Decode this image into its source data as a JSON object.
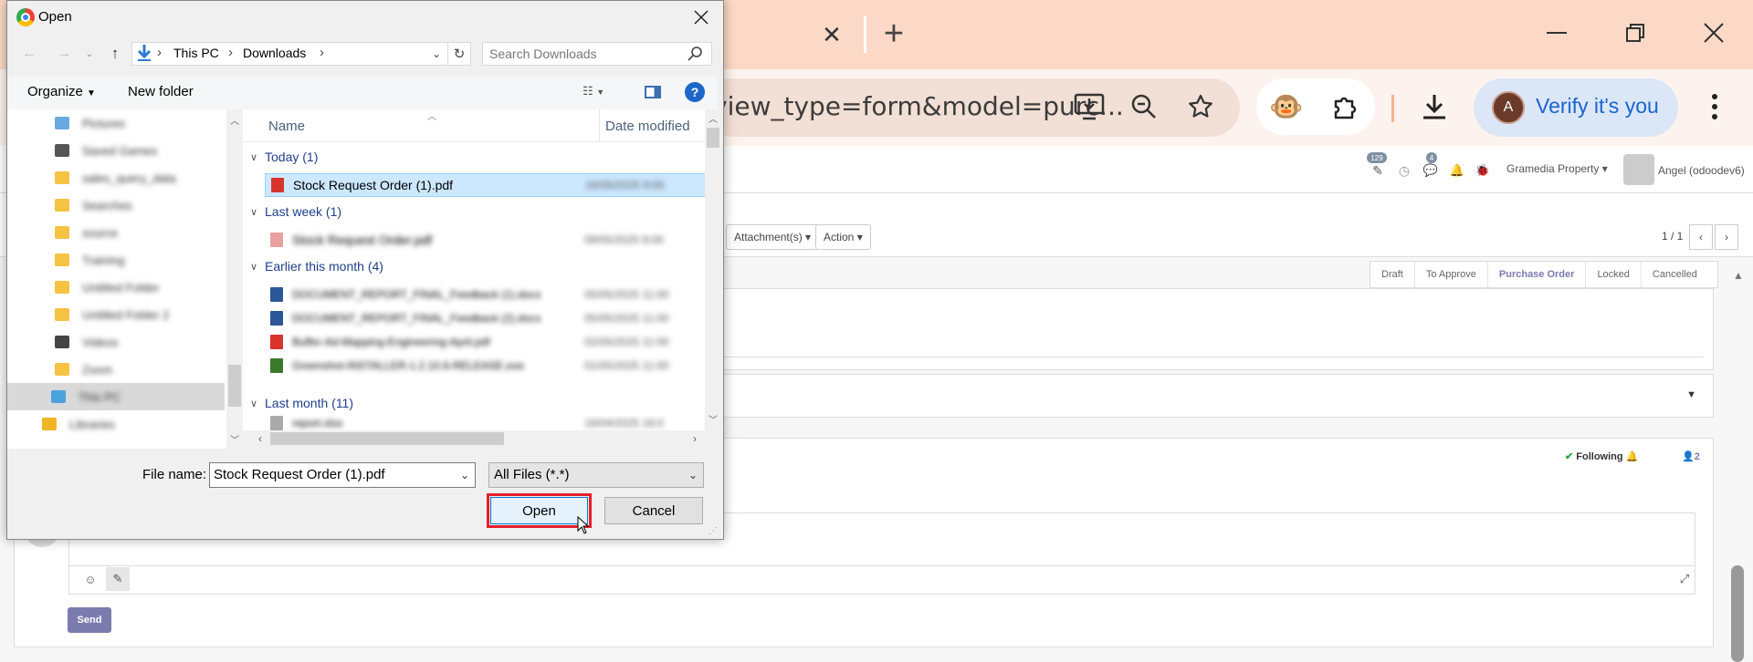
{
  "browser": {
    "tab_close": "✕",
    "tab_new": "+",
    "url": "view_type=form&model=purc...",
    "verify_label": "Verify it's you",
    "avatar_letter": "A"
  },
  "odoo": {
    "badge_activity": "129",
    "badge_messages": "4",
    "company": "Gramedia Property",
    "user": "Angel (odoodev6)",
    "attachments_label": "Attachment(s)",
    "action_label": "Action",
    "pager": "1 / 1",
    "stages": [
      "Draft",
      "To Approve",
      "Purchase Order",
      "Locked",
      "Cancelled"
    ],
    "active_stage": "Purchase Order",
    "following_label": "Following",
    "followers_count": "2",
    "send_label": "Send"
  },
  "dialog": {
    "title": "Open",
    "breadcrumb": [
      "This PC",
      "Downloads"
    ],
    "search_placeholder": "Search Downloads",
    "organize_label": "Organize",
    "new_folder_label": "New folder",
    "nav_items": [
      "Pictures",
      "Saved Games",
      "sales_query_data",
      "Searches",
      "source",
      "Training",
      "Untitled Folder",
      "Untitled Folder 2",
      "Videos",
      "Zoom",
      "This PC",
      "Libraries"
    ],
    "col_name": "Name",
    "col_date": "Date modified",
    "groups": [
      {
        "label": "Today (1)",
        "files": [
          {
            "name": "Stock Request Order (1).pdf",
            "date": "16/05/2025 9:00",
            "type": "pdf",
            "selected": true
          }
        ]
      },
      {
        "label": "Last week (1)",
        "files": [
          {
            "name": "Stock Request Order.pdf",
            "date": "09/05/2025 9:00",
            "type": "pdf",
            "selected": false
          }
        ]
      },
      {
        "label": "Earlier this month (4)",
        "files": [
          {
            "name": "DOCUMENT_REPORT_FINAL_Feedback (1).docx",
            "date": "05/05/2025 11:00",
            "type": "word"
          },
          {
            "name": "DOCUMENT_REPORT_FINAL_Feedback (2).docx",
            "date": "05/05/2025 11:00",
            "type": "word"
          },
          {
            "name": "Buffer-Ad-Mapping-Engineering-April.pdf",
            "date": "02/05/2025 11:00",
            "type": "pdf"
          },
          {
            "name": "Greenshot-INSTALLER-1.2.10.6-RELEASE.exe",
            "date": "01/05/2025 11:00",
            "type": "exe"
          }
        ]
      },
      {
        "label": "Last month (11)",
        "files": [
          {
            "name": "report.xlsx",
            "date": "16/04/2025 16:0",
            "type": "doc"
          }
        ]
      }
    ],
    "file_name_label": "File name:",
    "file_name_value": "Stock Request Order (1).pdf",
    "file_type": "All Files (*.*)",
    "open_label": "Open",
    "cancel_label": "Cancel"
  }
}
